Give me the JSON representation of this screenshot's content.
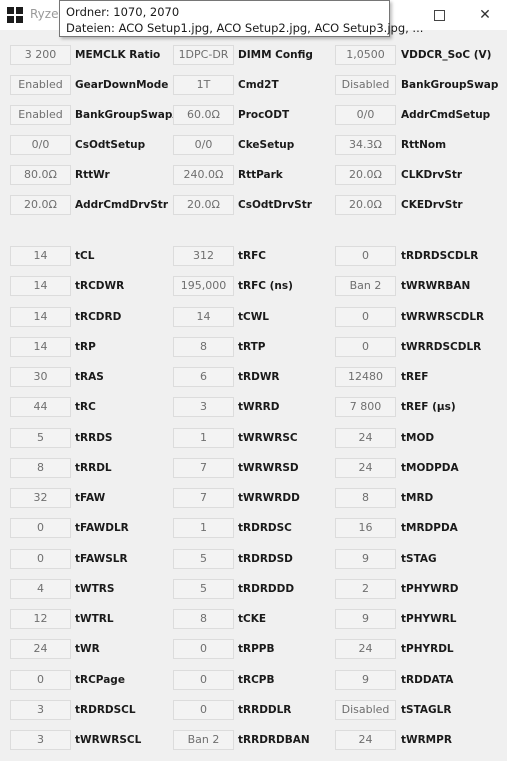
{
  "window": {
    "title": "Ryzen",
    "maximize_glyph": "maximize-icon",
    "close_glyph": "✕"
  },
  "tooltip": {
    "line1": "Ordner: 1070, 2070",
    "line2": "Dateien: ACO Setup1.jpg, ACO Setup2.jpg, ACO Setup3.jpg, ..."
  },
  "settings": [
    [
      {
        "value": "3 200",
        "label": "MEMCLK Ratio"
      },
      {
        "value": "1DPC-DR",
        "label": "DIMM Config"
      },
      {
        "value": "1,0500",
        "label": "VDDCR_SoC (V)"
      }
    ],
    [
      {
        "value": "Enabled",
        "label": "GearDownMode"
      },
      {
        "value": "1T",
        "label": "Cmd2T"
      },
      {
        "value": "Disabled",
        "label": "BankGroupSwap"
      }
    ],
    [
      {
        "value": "Enabled",
        "label": "BankGroupSwapAlt"
      },
      {
        "value": "60.0Ω",
        "label": "ProcODT"
      },
      {
        "value": "0/0",
        "label": "AddrCmdSetup"
      }
    ],
    [
      {
        "value": "0/0",
        "label": "CsOdtSetup"
      },
      {
        "value": "0/0",
        "label": "CkeSetup"
      },
      {
        "value": "34.3Ω",
        "label": "RttNom"
      }
    ],
    [
      {
        "value": "80.0Ω",
        "label": "RttWr"
      },
      {
        "value": "240.0Ω",
        "label": "RttPark"
      },
      {
        "value": "20.0Ω",
        "label": "CLKDrvStr"
      }
    ],
    [
      {
        "value": "20.0Ω",
        "label": "AddrCmdDrvStr"
      },
      {
        "value": "20.0Ω",
        "label": "CsOdtDrvStr"
      },
      {
        "value": "20.0Ω",
        "label": "CKEDrvStr"
      }
    ]
  ],
  "timings": [
    [
      {
        "value": "14",
        "label": "tCL"
      },
      {
        "value": "312",
        "label": "tRFC"
      },
      {
        "value": "0",
        "label": "tRDRDSCDLR"
      }
    ],
    [
      {
        "value": "14",
        "label": "tRCDWR"
      },
      {
        "value": "195,000",
        "label": "tRFC (ns)"
      },
      {
        "value": "Ban 2",
        "label": "tWRWRBAN"
      }
    ],
    [
      {
        "value": "14",
        "label": "tRCDRD"
      },
      {
        "value": "14",
        "label": "tCWL"
      },
      {
        "value": "0",
        "label": "tWRWRSCDLR"
      }
    ],
    [
      {
        "value": "14",
        "label": "tRP"
      },
      {
        "value": "8",
        "label": "tRTP"
      },
      {
        "value": "0",
        "label": "tWRRDSCDLR"
      }
    ],
    [
      {
        "value": "30",
        "label": "tRAS"
      },
      {
        "value": "6",
        "label": "tRDWR"
      },
      {
        "value": "12480",
        "label": "tREF"
      }
    ],
    [
      {
        "value": "44",
        "label": "tRC"
      },
      {
        "value": "3",
        "label": "tWRRD"
      },
      {
        "value": "7 800",
        "label": "tREF (µs)"
      }
    ],
    [
      {
        "value": "5",
        "label": "tRRDS"
      },
      {
        "value": "1",
        "label": "tWRWRSC"
      },
      {
        "value": "24",
        "label": "tMOD"
      }
    ],
    [
      {
        "value": "8",
        "label": "tRRDL"
      },
      {
        "value": "7",
        "label": "tWRWRSD"
      },
      {
        "value": "24",
        "label": "tMODPDA"
      }
    ],
    [
      {
        "value": "32",
        "label": "tFAW"
      },
      {
        "value": "7",
        "label": "tWRWRDD"
      },
      {
        "value": "8",
        "label": "tMRD"
      }
    ],
    [
      {
        "value": "0",
        "label": "tFAWDLR"
      },
      {
        "value": "1",
        "label": "tRDRDSC"
      },
      {
        "value": "16",
        "label": "tMRDPDA"
      }
    ],
    [
      {
        "value": "0",
        "label": "tFAWSLR"
      },
      {
        "value": "5",
        "label": "tRDRDSD"
      },
      {
        "value": "9",
        "label": "tSTAG"
      }
    ],
    [
      {
        "value": "4",
        "label": "tWTRS"
      },
      {
        "value": "5",
        "label": "tRDRDDD"
      },
      {
        "value": "2",
        "label": "tPHYWRD"
      }
    ],
    [
      {
        "value": "12",
        "label": "tWTRL"
      },
      {
        "value": "8",
        "label": "tCKE"
      },
      {
        "value": "9",
        "label": "tPHYWRL"
      }
    ],
    [
      {
        "value": "24",
        "label": "tWR"
      },
      {
        "value": "0",
        "label": "tRPPB"
      },
      {
        "value": "24",
        "label": "tPHYRDL"
      }
    ],
    [
      {
        "value": "0",
        "label": "tRCPage"
      },
      {
        "value": "0",
        "label": "tRCPB"
      },
      {
        "value": "9",
        "label": "tRDDATA"
      }
    ],
    [
      {
        "value": "3",
        "label": "tRDRDSCL"
      },
      {
        "value": "0",
        "label": "tRRDDLR"
      },
      {
        "value": "Disabled",
        "label": "tSTAGLR"
      }
    ],
    [
      {
        "value": "3",
        "label": "tWRWRSCL"
      },
      {
        "value": "Ban 2",
        "label": "tRRDRDBAN"
      },
      {
        "value": "24",
        "label": "tWRMPR"
      }
    ]
  ]
}
